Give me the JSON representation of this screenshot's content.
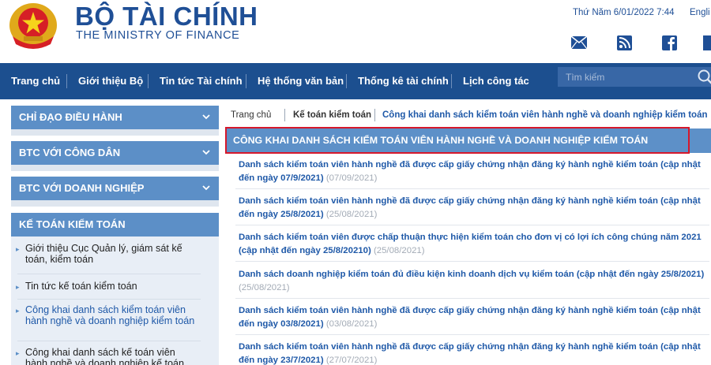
{
  "header": {
    "title": "BỘ TÀI CHÍNH",
    "subtitle": "THE MINISTRY OF FINANCE",
    "date": "Thứ Năm 6/01/2022 7:44",
    "language": "Engli",
    "social_icons": [
      "mail-icon",
      "rss-icon",
      "facebook-icon",
      "more-icon"
    ]
  },
  "nav": {
    "items": [
      "Trang chủ",
      "Giới thiệu Bộ",
      "Tin tức Tài chính",
      "Hệ thống văn bản",
      "Thống kê tài chính",
      "Lịch công tác"
    ],
    "search_placeholder": "Tìm kiếm"
  },
  "sidebar": {
    "sections": [
      "CHỈ ĐẠO ĐIỀU HÀNH",
      "BTC VỚI CÔNG DÂN",
      "BTC VỚI DOANH NGHIỆP"
    ],
    "active_section": "KẾ TOÁN KIỂM TOÁN",
    "links": [
      "Giới thiệu Cục Quản lý, giám sát kế toán, kiểm toán",
      "Tin tức kế toán kiểm toán",
      "Công khai danh sách kiểm toán viên hành nghề và doanh nghiệp kiểm toán",
      "Công khai danh sách kế toán viên hành nghề và doanh nghiệp kế toán"
    ]
  },
  "breadcrumb": [
    "Trang chủ",
    "Kế toán kiểm toán",
    "Công khai danh sách kiểm toán viên hành nghề và doanh nghiệp kiểm toán"
  ],
  "main": {
    "title": "CÔNG KHAI DANH SÁCH KIỂM TOÁN VIÊN HÀNH NGHỀ VÀ DOANH NGHIỆP KIỂM TOÁN",
    "items": [
      {
        "text": "Danh sách kiểm toán viên hành nghề đã được cấp giấy chứng nhận đăng ký hành nghề kiểm toán (cập nhật đến ngày 07/9/2021)",
        "date": "(07/09/2021)"
      },
      {
        "text": "Danh sách kiểm toán viên hành nghề đã được cấp giấy chứng nhận đăng ký hành nghề kiểm toán (cập nhật đến ngày 25/8/2021)",
        "date": "(25/08/2021)"
      },
      {
        "text": "Danh sách kiểm toán viên được chấp thuận thực hiện kiểm toán cho đơn vị có lợi ích công chúng năm 2021 (cập nhật đến ngày 25/8/20210)",
        "date": "(25/08/2021)"
      },
      {
        "text": "Danh sách doanh nghiệp kiểm toán đủ điều kiện kinh doanh dịch vụ kiểm toán (cập nhật đến ngày 25/8/2021)",
        "date": "(25/08/2021)"
      },
      {
        "text": "Danh sách kiểm toán viên hành nghề đã được cấp giấy chứng nhận đăng ký hành nghề kiểm toán (cập nhật đến ngày 03/8/2021)",
        "date": "(03/08/2021)"
      },
      {
        "text": "Danh sách kiểm toán viên hành nghề đã được cấp giấy chứng nhận đăng ký hành nghề kiểm toán (cập nhật đến ngày 23/7/2021)",
        "date": "(27/07/2021)"
      }
    ]
  },
  "colors": {
    "nav_bg": "#1c4f8f",
    "brand_blue": "#1f4f96",
    "sidebar_header": "#5c8fc7",
    "highlight": "#d6182b"
  }
}
